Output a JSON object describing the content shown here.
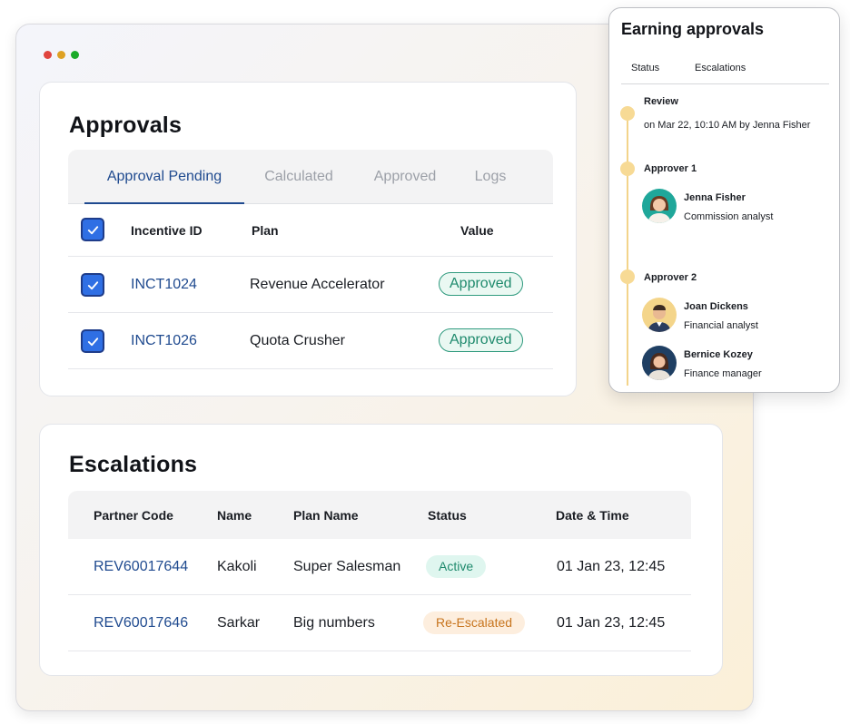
{
  "window": {
    "dots": [
      {
        "name": "close-dot",
        "color": "#e0443e"
      },
      {
        "name": "minimize-dot",
        "color": "#dea123"
      },
      {
        "name": "maximize-dot",
        "color": "#1aab29"
      }
    ]
  },
  "approvals": {
    "title": "Approvals",
    "tabs": [
      {
        "label": "Approval Pending",
        "active": true
      },
      {
        "label": "Calculated",
        "active": false
      },
      {
        "label": "Approved",
        "active": false
      },
      {
        "label": "Logs",
        "active": false
      }
    ],
    "columns": {
      "id": "Incentive ID",
      "plan": "Plan",
      "value": "Value"
    },
    "rows": [
      {
        "checked": true,
        "id": "INCT1024",
        "plan": "Revenue Accelerator",
        "value": "Approved"
      },
      {
        "checked": true,
        "id": "INCT1026",
        "plan": "Quota Crusher",
        "value": "Approved"
      }
    ]
  },
  "escalations": {
    "title": "Escalations",
    "columns": {
      "partner_code": "Partner Code",
      "name": "Name",
      "plan_name": "Plan Name",
      "status": "Status",
      "datetime": "Date & Time"
    },
    "rows": [
      {
        "partner_code": "REV60017644",
        "name": "Kakoli",
        "plan_name": "Super Salesman",
        "status": "Active",
        "datetime": "01 Jan 23, 12:45"
      },
      {
        "partner_code": "REV60017646",
        "name": "Sarkar",
        "plan_name": "Big numbers",
        "status": "Re-Escalated",
        "datetime": "01 Jan 23, 12:45"
      }
    ]
  },
  "earning_panel": {
    "title": "Earning approvals",
    "tabs": [
      "Status",
      "Escalations"
    ],
    "timeline": {
      "review": {
        "label": "Review",
        "text": "on Mar 22, 10:10 AM by Jenna Fisher"
      },
      "approver1": {
        "label": "Approver 1",
        "people": [
          {
            "name": "Jenna Fisher",
            "role": "Commission analyst",
            "avatar": "woman-avatar-teal"
          }
        ]
      },
      "approver2": {
        "label": "Approver 2",
        "people": [
          {
            "name": "Joan Dickens",
            "role": "Financial analyst",
            "avatar": "man-avatar-yellow"
          },
          {
            "name": "Bernice Kozey",
            "role": "Finance manager",
            "avatar": "woman-avatar-blue"
          }
        ]
      }
    }
  },
  "colors": {
    "accent": "#1f4a8f",
    "checkbox": "#2f6fe4",
    "approved_green": "#1f8a6d",
    "reescalated_orange": "#c7741d",
    "timeline_yellow": "#f7da95"
  }
}
